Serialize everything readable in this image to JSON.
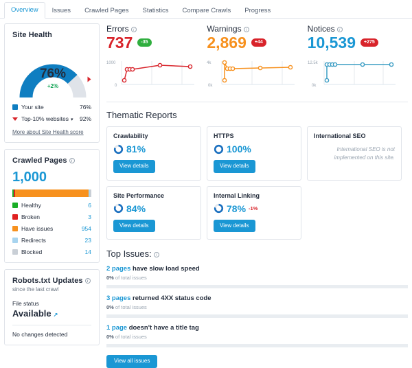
{
  "tabs": [
    {
      "label": "Overview",
      "active": true
    },
    {
      "label": "Issues",
      "active": false
    },
    {
      "label": "Crawled Pages",
      "active": false
    },
    {
      "label": "Statistics",
      "active": false
    },
    {
      "label": "Compare Crawls",
      "active": false
    },
    {
      "label": "Progress",
      "active": false
    }
  ],
  "site_health": {
    "title": "Site Health",
    "score": "76%",
    "delta": "+2%",
    "score_pct": 76,
    "benchmark_pct": 92,
    "legend": [
      {
        "label": "Your site",
        "value": "76%",
        "color": "#0f7ec1",
        "marker": "square"
      },
      {
        "label": "Top-10% websites",
        "value": "92%",
        "color": "#d8232a",
        "marker": "triangle",
        "caret": "⌄"
      }
    ],
    "more_link": "More about Site Health score"
  },
  "crawled_pages": {
    "title": "Crawled Pages",
    "total": "1,000",
    "segments": [
      {
        "label": "Healthy",
        "value": "6",
        "count": 6,
        "color": "#1aae26"
      },
      {
        "label": "Broken",
        "value": "3",
        "count": 3,
        "color": "#e02020"
      },
      {
        "label": "Have issues",
        "value": "954",
        "count": 954,
        "color": "#f7911e"
      },
      {
        "label": "Redirects",
        "value": "23",
        "count": 23,
        "color": "#a8d4ef"
      },
      {
        "label": "Blocked",
        "value": "14",
        "count": 14,
        "color": "#c9cfd6"
      }
    ]
  },
  "robots": {
    "title": "Robots.txt Updates",
    "subtitle": "since the last crawl",
    "file_status_label": "File status",
    "file_status_value": "Available",
    "external_icon": "external-link-icon",
    "note": "No changes detected"
  },
  "metrics": [
    {
      "name": "Errors",
      "value": "737",
      "color": "#d8232a",
      "badge": "-35",
      "badge_color": "#2fae3e",
      "axis_top": "1000",
      "axis_bottom": "0"
    },
    {
      "name": "Warnings",
      "value": "2,869",
      "color": "#f7911e",
      "badge": "+44",
      "badge_color": "#d8232a",
      "axis_top": "4k",
      "axis_bottom": "0k"
    },
    {
      "name": "Notices",
      "value": "10,539",
      "color": "#1a97d4",
      "badge": "+275",
      "badge_color": "#d8232a",
      "axis_top": "12.5k",
      "axis_bottom": "0k"
    }
  ],
  "chart_data": [
    {
      "type": "line",
      "title": "Errors",
      "ylabel": "",
      "xlabel": "",
      "ylim": [
        0,
        1000
      ],
      "ytick_labels": [
        "1000",
        "0"
      ],
      "grid": true,
      "series": [
        {
          "name": "Errors",
          "color": "#d8232a",
          "x": [
            0,
            4,
            9,
            14,
            47,
            92
          ],
          "values": [
            200,
            640,
            645,
            650,
            790,
            760
          ]
        }
      ]
    },
    {
      "type": "line",
      "title": "Warnings",
      "ylabel": "",
      "xlabel": "",
      "ylim": [
        0,
        4000
      ],
      "ytick_labels": [
        "4k",
        "0k"
      ],
      "grid": true,
      "series": [
        {
          "name": "Warnings",
          "color": "#f7911e",
          "x": [
            0,
            0,
            5,
            10,
            15,
            48,
            92
          ],
          "values": [
            400,
            3750,
            2850,
            2840,
            2830,
            2860,
            2869
          ]
        }
      ]
    },
    {
      "type": "line",
      "title": "Notices",
      "ylabel": "",
      "xlabel": "",
      "ylim": [
        0,
        12500
      ],
      "ytick_labels": [
        "12.5k",
        "0k"
      ],
      "grid": true,
      "series": [
        {
          "name": "Notices",
          "color": "#3b9dc4",
          "x": [
            0,
            0,
            5,
            10,
            15,
            48,
            92
          ],
          "values": [
            1600,
            10450,
            10480,
            10500,
            10520,
            10530,
            10539
          ]
        }
      ]
    }
  ],
  "thematic": {
    "title": "Thematic Reports",
    "cards": [
      {
        "name": "Crawlability",
        "pct": "81%",
        "value": 81,
        "delta": "",
        "button": "View details",
        "empty": ""
      },
      {
        "name": "HTTPS",
        "pct": "100%",
        "value": 100,
        "delta": "",
        "button": "View details",
        "empty": ""
      },
      {
        "name": "International SEO",
        "pct": "",
        "value": 0,
        "delta": "",
        "button": "",
        "empty": "International SEO is not implemented on this site."
      },
      {
        "name": "Site Performance",
        "pct": "84%",
        "value": 84,
        "delta": "",
        "button": "View details",
        "empty": ""
      },
      {
        "name": "Internal Linking",
        "pct": "78%",
        "value": 78,
        "delta": "-1%",
        "button": "View details",
        "empty": ""
      }
    ]
  },
  "top_issues": {
    "title": "Top Issues:",
    "items": [
      {
        "count": "2 pages",
        "text": " have slow load speed",
        "sub_pct": "0%",
        "sub_rest": " of total issues"
      },
      {
        "count": "3 pages",
        "text": " returned 4XX status code",
        "sub_pct": "0%",
        "sub_rest": " of total issues"
      },
      {
        "count": "1 page",
        "text": " doesn't have a title tag",
        "sub_pct": "0%",
        "sub_rest": " of total issues"
      }
    ],
    "view_all": "View all issues"
  }
}
